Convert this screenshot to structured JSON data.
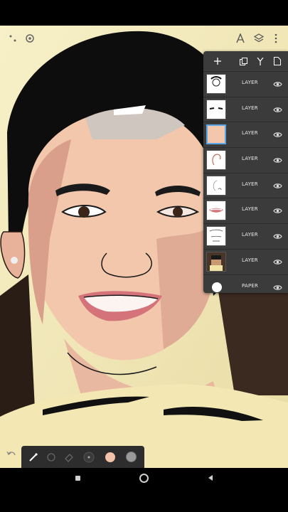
{
  "layers": {
    "rows": [
      {
        "label": "LAYER",
        "thumb": "face-outline"
      },
      {
        "label": "LAYER",
        "thumb": "eyebrows"
      },
      {
        "label": "LAYER",
        "thumb": "skin-fill"
      },
      {
        "label": "LAYER",
        "thumb": "ear-sketch"
      },
      {
        "label": "LAYER",
        "thumb": "nose-sketch"
      },
      {
        "label": "LAYER",
        "thumb": "lips"
      },
      {
        "label": "LAYER",
        "thumb": "lineart"
      },
      {
        "label": "LAYER",
        "thumb": "photo"
      }
    ],
    "paper_label": "PAPER"
  },
  "colors": {
    "accent": "#5aa6e6",
    "skin": "#f2c7ac",
    "panel": "#3b3b3b",
    "brushbar": "#2d2d2d",
    "swatch_primary": "#f4c2aa",
    "swatch_secondary": "#9a9a9a"
  },
  "icons": [
    "grip-icon",
    "settings-icon",
    "symmetry-icon",
    "layers-icon",
    "more-icon",
    "add-layer-icon",
    "duplicate-icon",
    "merge-icon",
    "file-icon",
    "eye-icon",
    "brush-icon",
    "smudge-icon",
    "eraser-icon",
    "brush-size-icon",
    "undo-icon",
    "recents-icon",
    "home-icon",
    "back-icon"
  ]
}
